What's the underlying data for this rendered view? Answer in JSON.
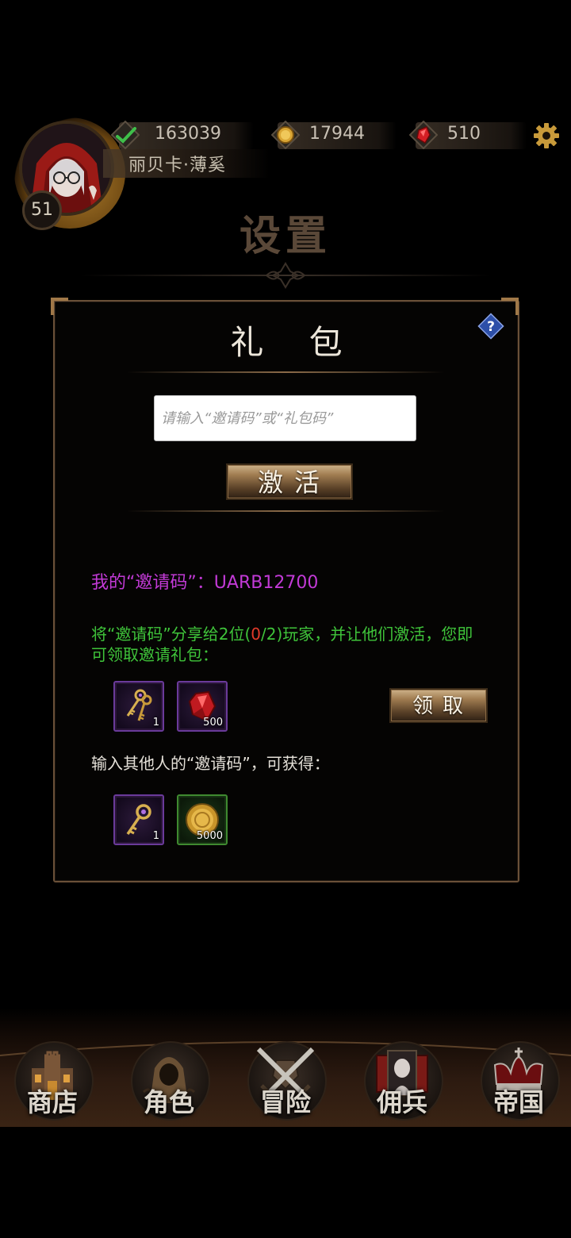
{
  "header": {
    "level": "51",
    "player_name": "丽贝卡·薄奚",
    "resources": [
      {
        "icon": "check-icon",
        "value": "163039"
      },
      {
        "icon": "gold-coin-icon",
        "value": "17944"
      },
      {
        "icon": "red-gem-icon",
        "value": "510"
      }
    ],
    "settings_icon": "gear-icon"
  },
  "page_title": "设置",
  "panel": {
    "title": "礼 包",
    "help_label": "?",
    "input_placeholder": "请输入“邀请码”或“礼包码”",
    "input_value": "",
    "activate_label": "激活",
    "my_code_text": "我的“邀请码”：UARB12700",
    "share_text_before": "将“邀请码”分享给2位(",
    "share_progress": "0",
    "share_text_after": "/2)玩家，并让他们激活，您即可领取邀请礼包：",
    "claim_label": "领取",
    "invite_rewards": [
      {
        "icon": "golden-keys-icon",
        "count": "1",
        "rarity": "purple"
      },
      {
        "icon": "red-gem-icon",
        "count": "500",
        "rarity": "purple"
      }
    ],
    "other_text": "输入其他人的“邀请码”，可获得：",
    "input_rewards": [
      {
        "icon": "golden-key-icon",
        "count": "1",
        "rarity": "purple"
      },
      {
        "icon": "gold-coin-icon",
        "count": "5000",
        "rarity": "green"
      }
    ]
  },
  "nav": [
    {
      "id": "shop",
      "label": "商店",
      "icon": "castle-icon"
    },
    {
      "id": "character",
      "label": "角色",
      "icon": "hooded-figure-icon"
    },
    {
      "id": "adventure",
      "label": "冒险",
      "icon": "crossed-swords-icon"
    },
    {
      "id": "mercenary",
      "label": "佣兵",
      "icon": "portrait-cards-icon"
    },
    {
      "id": "empire",
      "label": "帝国",
      "icon": "crown-icon"
    }
  ],
  "colors": {
    "invite_code": "#c23ad6",
    "share_text": "#3fc43a",
    "progress_red": "#e23a2a",
    "panel_border": "#6a5038"
  }
}
